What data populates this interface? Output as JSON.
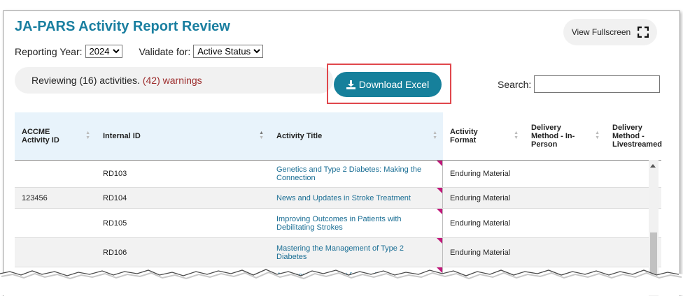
{
  "header": {
    "title": "JA-PARS Activity Report Review",
    "fullscreen_label": "View Fullscreen"
  },
  "filters": {
    "year_label": "Reporting Year:",
    "year_value": "2024",
    "validate_label": "Validate for:",
    "validate_value": "Active Status"
  },
  "summary": {
    "text": "Reviewing (16) activities.",
    "warnings": "(42) warnings"
  },
  "download": {
    "label": "Download Excel"
  },
  "search": {
    "label": "Search:",
    "value": ""
  },
  "table": {
    "columns": [
      "ACCME Activity ID",
      "Internal ID",
      "Activity Title",
      "Activity Format",
      "Delivery Method - In-Person",
      "Delivery Method - Livestreamed"
    ],
    "rows": [
      {
        "accme_id": "",
        "internal_id": "RD103",
        "title": "Genetics and Type 2 Diabetes: Making the Connection",
        "format": "Enduring Material"
      },
      {
        "accme_id": "123456",
        "internal_id": "RD104",
        "title": "News and Updates in Stroke Treatment",
        "format": "Enduring Material"
      },
      {
        "accme_id": "",
        "internal_id": "RD105",
        "title": "Improving Outcomes in Patients with Debilitating Strokes",
        "format": "Enduring Material"
      },
      {
        "accme_id": "",
        "internal_id": "RD106",
        "title": "Mastering the Management of Type 2 Diabetes",
        "format": "Enduring Material"
      },
      {
        "accme_id": "",
        "internal_id": "",
        "title": "Advanced Treatment for Stroke",
        "format": ""
      }
    ]
  },
  "colors": {
    "title": "#1a7fa0",
    "button": "#16809b",
    "highlight": "#e0474c",
    "warning": "#9c2b2b",
    "header_bg": "#e8f3fb",
    "flag": "#c0177a"
  }
}
